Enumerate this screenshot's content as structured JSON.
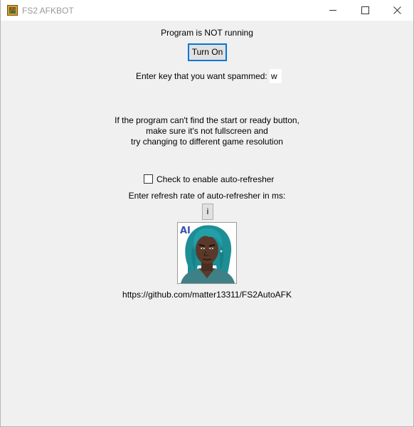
{
  "window": {
    "title": "FS2 AFKBOT",
    "app_icon": "app-icon",
    "controls": {
      "minimize_icon": "minimize-icon",
      "maximize_icon": "maximize-icon",
      "close_icon": "close-icon"
    }
  },
  "main": {
    "status_text": "Program is NOT running",
    "toggle_button_label": "Turn On",
    "key_label": "Enter key that you want spammed:",
    "key_value": "w",
    "info_lines": [
      "If the program can't find the start or ready button,",
      "make sure it's not fullscreen and",
      "try changing to different game resolution"
    ],
    "autorefresh_checkbox_label": "Check to enable auto-refresher",
    "autorefresh_checked": false,
    "refresh_rate_label": "Enter refresh rate of auto-refresher in ms:",
    "info_button_label": "i",
    "avatar_badge": "AI",
    "github_link": "https://github.com/matter13311/FS2AutoAFK"
  },
  "colors": {
    "background": "#f0f0f0",
    "titlebar": "#ffffff",
    "title_text": "#999999",
    "button_face": "#e1e1e1",
    "button_border": "#adadad",
    "focus_border": "#0078d7",
    "avatar_hair": "#1e8e96",
    "avatar_badge": "#3a4fb0"
  }
}
